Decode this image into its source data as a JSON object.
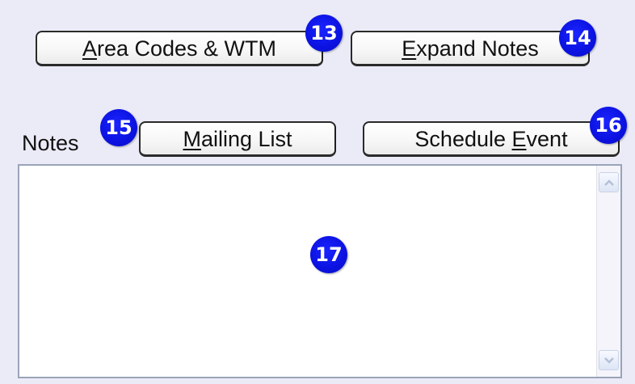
{
  "buttons": {
    "area_codes": {
      "pre": "",
      "accel": "A",
      "post": "rea Codes & WTM"
    },
    "expand_notes": {
      "pre": "",
      "accel": "E",
      "post": "xpand Notes"
    },
    "mailing_list": {
      "pre": "",
      "accel": "M",
      "post": "ailing List"
    },
    "schedule_event": {
      "pre": "Schedule ",
      "accel": "E",
      "post": "vent"
    }
  },
  "notes": {
    "label": "Notes",
    "value": ""
  },
  "badges": {
    "b13": "13",
    "b14": "14",
    "b15": "15",
    "b16": "16",
    "b17": "17"
  },
  "icons": {
    "scroll_up": "chevron-up-icon",
    "scroll_down": "chevron-down-icon"
  },
  "colors": {
    "background": "#ebebf8",
    "badge": "#0b12e0",
    "badge_text": "#ffffff"
  }
}
